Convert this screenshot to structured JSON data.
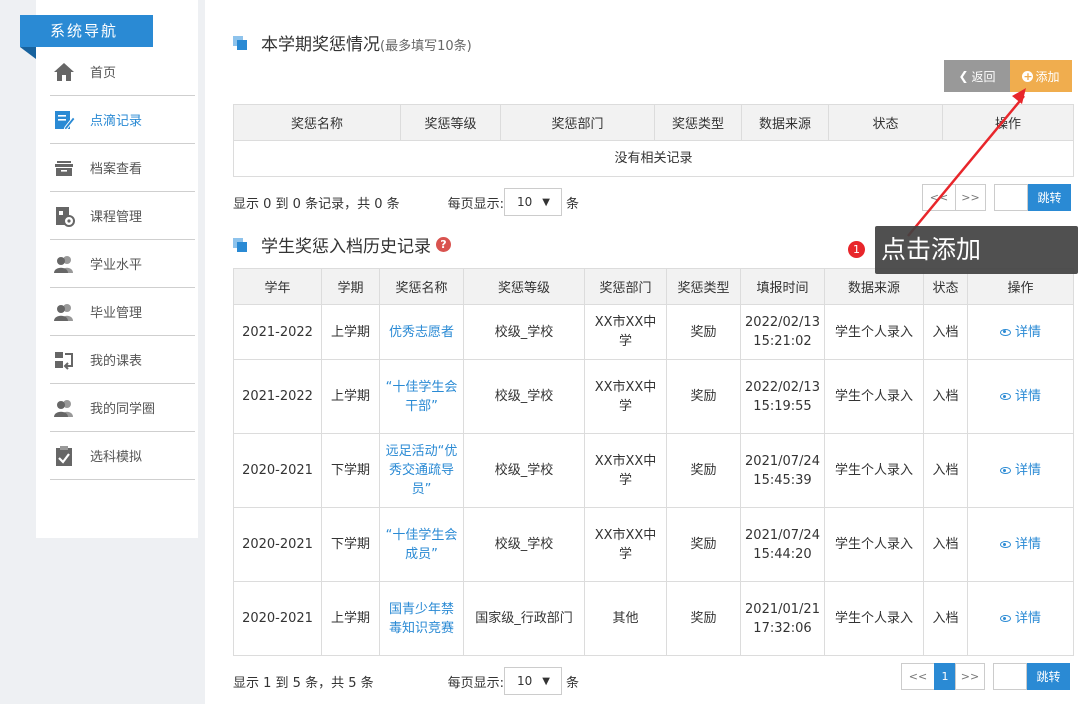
{
  "sidebar": {
    "title": "系统导航",
    "items": [
      {
        "label": "首页",
        "icon": "home-icon"
      },
      {
        "label": "点滴记录",
        "icon": "edit-icon"
      },
      {
        "label": "档案查看",
        "icon": "archive-icon"
      },
      {
        "label": "课程管理",
        "icon": "course-icon"
      },
      {
        "label": "学业水平",
        "icon": "users-icon"
      },
      {
        "label": "毕业管理",
        "icon": "users-icon"
      },
      {
        "label": "我的课表",
        "icon": "schedule-icon"
      },
      {
        "label": "我的同学圈",
        "icon": "users-icon"
      },
      {
        "label": "选科模拟",
        "icon": "clipboard-icon"
      }
    ]
  },
  "section1": {
    "title": "本学期奖惩情况",
    "note": "(最多填写10条)",
    "back_label": "返回",
    "add_label": "添加",
    "headers": [
      "奖惩名称",
      "奖惩等级",
      "奖惩部门",
      "奖惩类型",
      "数据来源",
      "状态",
      "操作"
    ],
    "empty": "没有相关记录",
    "info": "显示 0 到 0 条记录，共 0 条",
    "per_page_label": "每页显示:",
    "per_page_value": "10",
    "per_page_suffix": "条",
    "prev": "<<",
    "next": ">>",
    "go": "跳转"
  },
  "section2": {
    "title": "学生奖惩入档历史记录",
    "headers": [
      "学年",
      "学期",
      "奖惩名称",
      "奖惩等级",
      "奖惩部门",
      "奖惩类型",
      "填报时间",
      "数据来源",
      "状态",
      "操作"
    ],
    "rows": [
      {
        "year": "2021-2022",
        "term": "上学期",
        "name": "优秀志愿者",
        "level": "校级_学校",
        "dept": "XX市XX中学",
        "type": "奖励",
        "time": "2022/02/13 15:21:02",
        "source": "学生个人录入",
        "status": "入档",
        "action": "详情"
      },
      {
        "year": "2021-2022",
        "term": "上学期",
        "name": "“十佳学生会干部”",
        "level": "校级_学校",
        "dept": "XX市XX中学",
        "type": "奖励",
        "time": "2022/02/13 15:19:55",
        "source": "学生个人录入",
        "status": "入档",
        "action": "详情"
      },
      {
        "year": "2020-2021",
        "term": "下学期",
        "name": "远足活动“优秀交通疏导员”",
        "level": "校级_学校",
        "dept": "XX市XX中学",
        "type": "奖励",
        "time": "2021/07/24 15:45:39",
        "source": "学生个人录入",
        "status": "入档",
        "action": "详情"
      },
      {
        "year": "2020-2021",
        "term": "下学期",
        "name": "“十佳学生会成员”",
        "level": "校级_学校",
        "dept": "XX市XX中学",
        "type": "奖励",
        "time": "2021/07/24 15:44:20",
        "source": "学生个人录入",
        "status": "入档",
        "action": "详情"
      },
      {
        "year": "2020-2021",
        "term": "上学期",
        "name": "国青少年禁毒知识竞赛",
        "level": "国家级_行政部门",
        "dept": "其他",
        "type": "奖励",
        "time": "2021/01/21 17:32:06",
        "source": "学生个人录入",
        "status": "入档",
        "action": "详情"
      }
    ],
    "info": "显示 1 到 5 条，共 5 条",
    "per_page_label": "每页显示:",
    "per_page_value": "10",
    "per_page_suffix": "条",
    "prev": "<<",
    "page": "1",
    "next": ">>",
    "go": "跳转"
  },
  "annotation": {
    "badge": "1",
    "text": "点击添加",
    "color": "#e8262b"
  }
}
